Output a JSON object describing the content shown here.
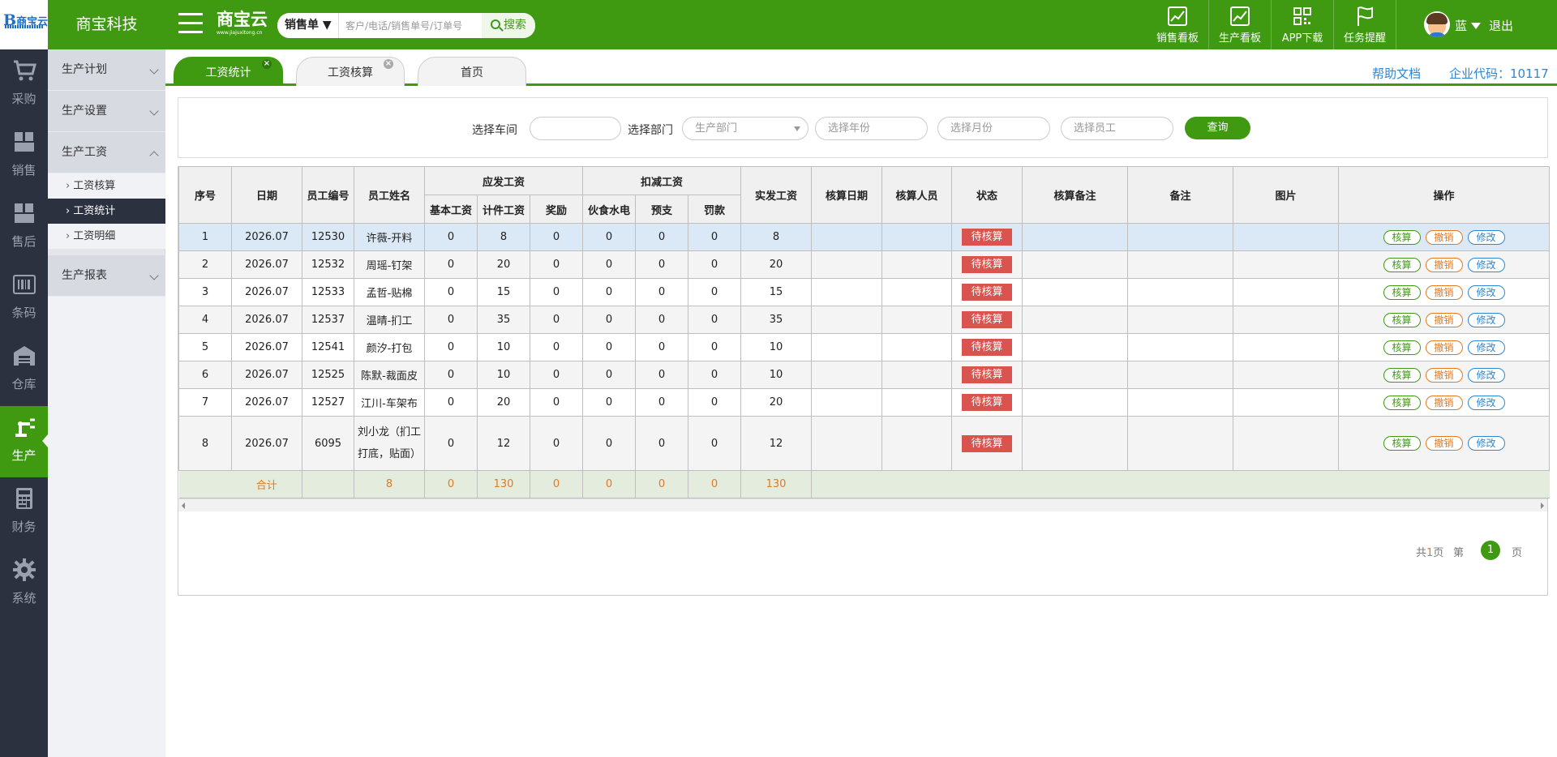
{
  "header": {
    "company": "商宝科技",
    "logo_text": "商宝云",
    "brand_name": "商宝云",
    "brand_url": "www.jiajuxitong.cn",
    "search_type": "销售单 ▼",
    "search_placeholder": "客户/电话/销售单号/订单号",
    "search_button": "搜索",
    "tools": [
      {
        "label": "销售看板",
        "icon": "sales-board-icon"
      },
      {
        "label": "生产看板",
        "icon": "production-board-icon"
      },
      {
        "label": "APP下载",
        "icon": "qr-code-icon"
      },
      {
        "label": "任务提醒",
        "icon": "flag-icon"
      }
    ],
    "user": "蓝",
    "logout": "退出"
  },
  "rail": [
    {
      "label": "采购",
      "icon": "cart-icon"
    },
    {
      "label": "销售",
      "icon": "sales-icon"
    },
    {
      "label": "售后",
      "icon": "after-sales-icon"
    },
    {
      "label": "条码",
      "icon": "barcode-icon"
    },
    {
      "label": "仓库",
      "icon": "warehouse-icon"
    },
    {
      "label": "生产",
      "icon": "robot-arm-icon"
    },
    {
      "label": "财务",
      "icon": "calculator-icon"
    },
    {
      "label": "系统",
      "icon": "gear-icon"
    }
  ],
  "submenu": {
    "groups": [
      "生产计划",
      "生产设置",
      "生产工资",
      "生产报表"
    ],
    "items": [
      "工资核算",
      "工资统计",
      "工资明细"
    ]
  },
  "tabs": [
    "工资统计",
    "工资核算",
    "首页"
  ],
  "help": "帮助文档",
  "corp": "企业代码：10117",
  "filter": {
    "workshop_label": "选择车间",
    "dept_label": "选择部门",
    "dept_placeholder": "生产部门",
    "year_placeholder": "选择年份",
    "month_placeholder": "选择月份",
    "staff_placeholder": "选择员工",
    "query": "查询"
  },
  "table": {
    "headers": {
      "seq": "序号",
      "date": "日期",
      "emp_no": "员工编号",
      "emp_name": "员工姓名",
      "payable": "应发工资",
      "deduct": "扣减工资",
      "actual": "实发工资",
      "calc_date": "核算日期",
      "calc_person": "核算人员",
      "status": "状态",
      "calc_note": "核算备注",
      "note": "备注",
      "image": "图片",
      "ops": "操作",
      "base": "基本工资",
      "piece": "计件工资",
      "bonus": "奖励",
      "meal": "伙食水电",
      "advance": "预支",
      "fine": "罚款"
    },
    "rows": [
      {
        "seq": "1",
        "date": "2026.07",
        "no": "12530",
        "name": "许薇-开料",
        "base": "0",
        "piece": "8",
        "bonus": "0",
        "meal": "0",
        "adv": "0",
        "fine": "0",
        "actual": "8",
        "status": "待核算"
      },
      {
        "seq": "2",
        "date": "2026.07",
        "no": "12532",
        "name": "周瑶-钉架",
        "base": "0",
        "piece": "20",
        "bonus": "0",
        "meal": "0",
        "adv": "0",
        "fine": "0",
        "actual": "20",
        "status": "待核算"
      },
      {
        "seq": "3",
        "date": "2026.07",
        "no": "12533",
        "name": "孟哲-贴棉",
        "base": "0",
        "piece": "15",
        "bonus": "0",
        "meal": "0",
        "adv": "0",
        "fine": "0",
        "actual": "15",
        "status": "待核算"
      },
      {
        "seq": "4",
        "date": "2026.07",
        "no": "12537",
        "name": "温晴-扪工",
        "base": "0",
        "piece": "35",
        "bonus": "0",
        "meal": "0",
        "adv": "0",
        "fine": "0",
        "actual": "35",
        "status": "待核算"
      },
      {
        "seq": "5",
        "date": "2026.07",
        "no": "12541",
        "name": "颜汐-打包",
        "base": "0",
        "piece": "10",
        "bonus": "0",
        "meal": "0",
        "adv": "0",
        "fine": "0",
        "actual": "10",
        "status": "待核算"
      },
      {
        "seq": "6",
        "date": "2026.07",
        "no": "12525",
        "name": "陈默-裁面皮",
        "base": "0",
        "piece": "10",
        "bonus": "0",
        "meal": "0",
        "adv": "0",
        "fine": "0",
        "actual": "10",
        "status": "待核算"
      },
      {
        "seq": "7",
        "date": "2026.07",
        "no": "12527",
        "name": "江川-车架布",
        "base": "0",
        "piece": "20",
        "bonus": "0",
        "meal": "0",
        "adv": "0",
        "fine": "0",
        "actual": "20",
        "status": "待核算"
      },
      {
        "seq": "8",
        "date": "2026.07",
        "no": "6095",
        "name": "刘小龙（扪工打底，贴面）",
        "base": "0",
        "piece": "12",
        "bonus": "0",
        "meal": "0",
        "adv": "0",
        "fine": "0",
        "actual": "12",
        "status": "待核算"
      }
    ],
    "ops": {
      "calc": "核算",
      "revoke": "撤销",
      "edit": "修改"
    },
    "total": {
      "label": "合计",
      "name": "8",
      "base": "0",
      "piece": "130",
      "bonus": "0",
      "meal": "0",
      "adv": "0",
      "fine": "0",
      "actual": "130"
    }
  },
  "pager": {
    "total_prefix": "共",
    "total_pages": "1",
    "total_suffix": "页",
    "page_prefix": "第",
    "current": "1",
    "page_suffix": "页"
  },
  "colors": {
    "primary": "#3f9a12",
    "rail": "#2c3140",
    "pending": "#d9534f",
    "link": "#2f86d1",
    "sum": "#e27a24"
  }
}
